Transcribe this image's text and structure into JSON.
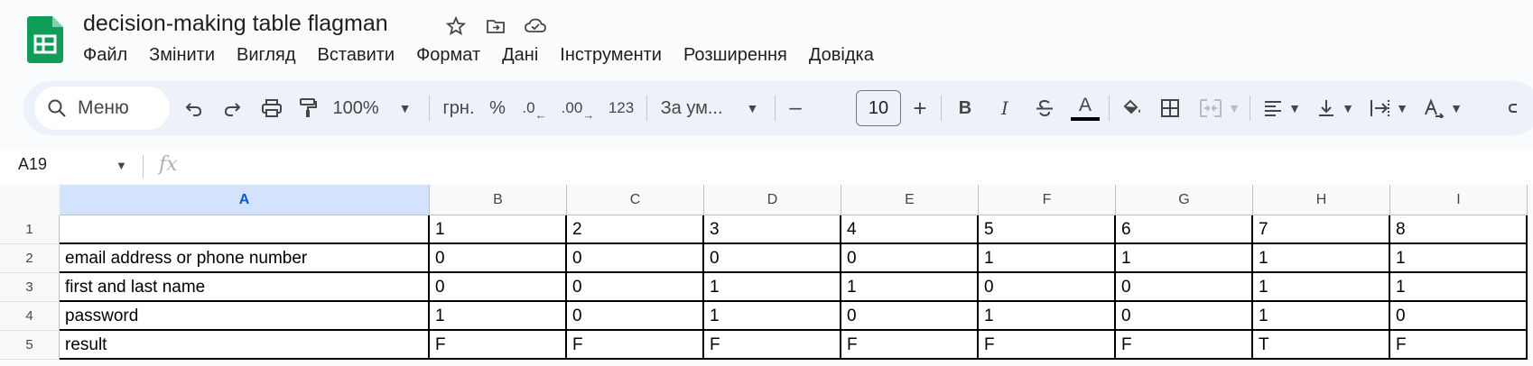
{
  "doc": {
    "title": "decision-making table flagman"
  },
  "menu": [
    "Файл",
    "Змінити",
    "Вигляд",
    "Вставити",
    "Формат",
    "Дані",
    "Інструменти",
    "Розширення",
    "Довідка"
  ],
  "toolbar": {
    "search_label": "Меню",
    "zoom": "100%",
    "currency": "грн.",
    "percent": "%",
    "dec_decrease": ".0",
    "dec_increase": ".00",
    "number_format": "123",
    "font": "За ум...",
    "font_size": "10",
    "minus": "–",
    "plus": "+",
    "bold": "B",
    "italic": "I",
    "text_color_glyph": "A"
  },
  "formula_bar": {
    "cell_ref": "A19",
    "fx": "fx"
  },
  "sheet": {
    "columns": [
      "A",
      "B",
      "C",
      "D",
      "E",
      "F",
      "G",
      "H",
      "I"
    ],
    "rows": [
      "1",
      "2",
      "3",
      "4",
      "5"
    ],
    "cells": [
      [
        "",
        "1",
        "2",
        "3",
        "4",
        "5",
        "6",
        "7",
        "8"
      ],
      [
        "email address or phone number",
        "0",
        "0",
        "0",
        "0",
        "1",
        "1",
        "1",
        "1"
      ],
      [
        "first and last name",
        "0",
        "0",
        "1",
        "1",
        "0",
        "0",
        "1",
        "1"
      ],
      [
        "password",
        "1",
        "0",
        "1",
        "0",
        "1",
        "0",
        "1",
        "0"
      ],
      [
        "result",
        "F",
        "F",
        "F",
        "F",
        "F",
        "F",
        "T",
        "F"
      ]
    ]
  },
  "colors": {
    "accent": "#0b57d0",
    "selected_header": "#d3e3fd",
    "sheets_green": "#0f9d58"
  }
}
